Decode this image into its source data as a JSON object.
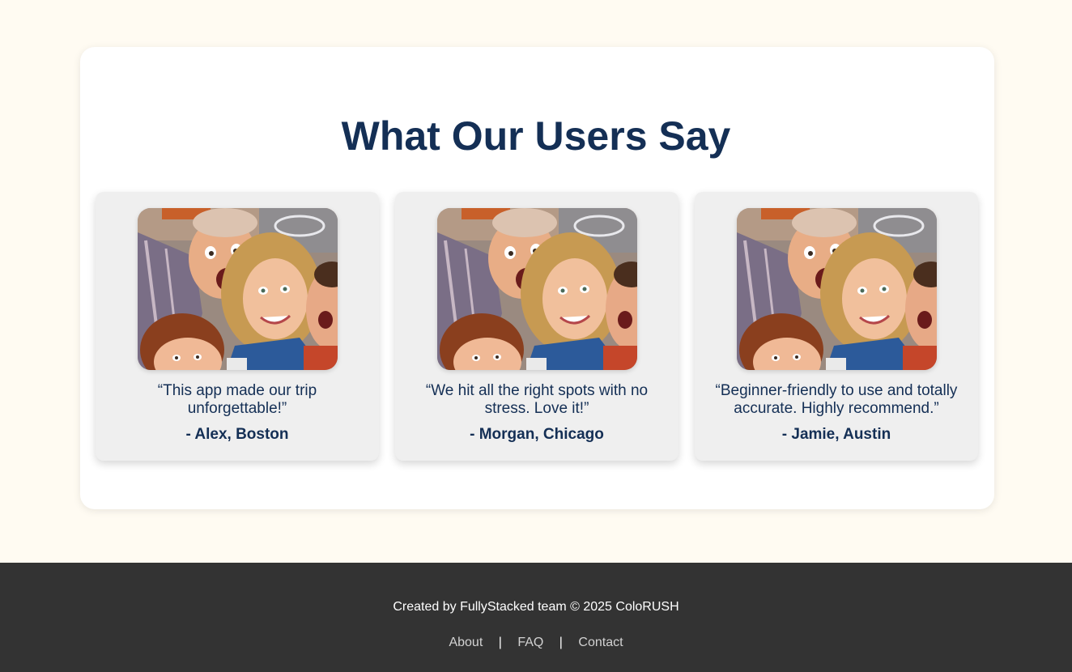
{
  "section": {
    "title": "What Our Users Say"
  },
  "testimonials": [
    {
      "quote": "“This app made our trip unforgettable!”",
      "author": "- Alex, Boston",
      "image": "family-selfie-photo"
    },
    {
      "quote": "“We hit all the right spots with no stress. Love it!”",
      "author": "- Morgan, Chicago",
      "image": "family-selfie-photo"
    },
    {
      "quote": "“Beginner-friendly to use and totally accurate. Highly recommend.”",
      "author": "- Jamie, Austin",
      "image": "family-selfie-photo"
    }
  ],
  "footer": {
    "credit": "Created by FullyStacked team © 2025 ColoRUSH",
    "links": [
      "About",
      "FAQ",
      "Contact"
    ],
    "separator": "|"
  },
  "colors": {
    "page_background": "#fffbf2",
    "card_background": "#ffffff",
    "testimonial_background": "#efefef",
    "text_navy": "#142f55",
    "footer_background": "#333333",
    "footer_link": "#d2d2d2"
  }
}
